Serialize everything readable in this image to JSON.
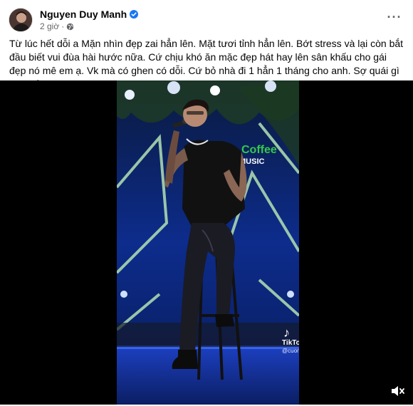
{
  "post": {
    "author_name": "Nguyen Duy Manh",
    "time_label": "2 giờ",
    "separator": "·",
    "more_label": "···",
    "text": "Từ lúc hết dỗi a Mặn nhìn đẹp zai hẳn lên. Mặt tươi tỉnh hẳn lên. Bớt stress và lại còn bắt đầu biết vui đùa hài hước nữa. Cứ chịu khó ăn mặc đẹp hát hay lên sân khấu cho gái đẹp nó mê em ạ. Vk mà có ghen có dỗi. Cứ bỏ nhà đi 1 hẳn 1 tháng cho anh. Sợ quái gì em nhỉ?"
  },
  "video": {
    "stage_sign_top": "Coffee",
    "stage_sign_bottom": "MUSIC",
    "watermark_logo": "♪",
    "watermark_label": "TikTok",
    "watermark_handle": "@cuongbao"
  },
  "colors": {
    "verified_blue": "#1877f2",
    "meta_gray": "#65676b",
    "stage_blue": "#0d2c8c",
    "sign_green": "#35c84a"
  },
  "icons": {
    "verified": "verified-badge-icon",
    "privacy": "globe-icon",
    "more": "more-options-icon",
    "volume": "volume-muted-icon"
  }
}
